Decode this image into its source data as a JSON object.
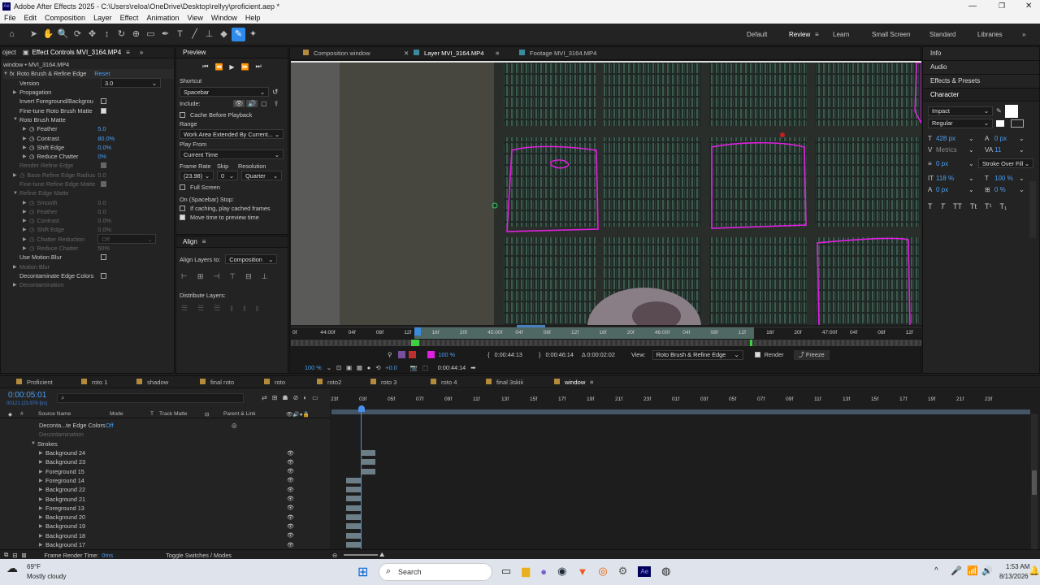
{
  "app": {
    "title": "Adobe After Effects 2025 - C:\\Users\\reloa\\OneDrive\\Desktop\\rellyy\\proficient.aep *"
  },
  "menu": [
    "File",
    "Edit",
    "Composition",
    "Layer",
    "Effect",
    "Animation",
    "View",
    "Window",
    "Help"
  ],
  "workspaces": [
    "Default",
    "Review",
    "Learn",
    "Small Screen",
    "Standard",
    "Libraries"
  ],
  "effect_panel": {
    "tab_left": "oject",
    "tab_title": "Effect Controls MVI_3164.MP4",
    "layer_label": "window • MVI_3164.MP4",
    "effect_name": "Roto Brush & Refine Edge",
    "reset": "Reset",
    "version_label": "Version",
    "version_value": "3.0",
    "propagation": "Propagation",
    "invert": "Invert Foreground/Backgrou",
    "finetune": "Fine-tune Roto Brush Matte",
    "roto_matte": "Roto Brush Matte",
    "feather": "Feather",
    "feather_v": "5.0",
    "contrast": "Contrast",
    "contrast_v": "80.0%",
    "shift": "Shift Edge",
    "shift_v": "0.0%",
    "reduce": "Reduce Chatter",
    "reduce_v": "0%",
    "render_refine": "Render Refine Edge",
    "base_radius": "Base Refine Edge Radius",
    "base_radius_v": "0.0",
    "finetune_refine": "Fine-tune Refine Edge Matte",
    "refine_matte": "Refine Edge Matte",
    "smooth": "Smooth",
    "smooth_v": "0.0",
    "feather2": "Feather",
    "feather2_v": "0.0",
    "contrast2": "Contrast",
    "contrast2_v": "0.0%",
    "shift2": "Shift Edge",
    "shift2_v": "0.0%",
    "chatter_red": "Chatter Reduction",
    "chatter_red_v": "Off",
    "reduce2": "Reduce Chatter",
    "reduce2_v": "50%",
    "motion_blur": "Use Motion Blur",
    "motion_blur2": "Motion Blur",
    "decont": "Decontaminate Edge Colors",
    "decont2": "Decontamination"
  },
  "preview": {
    "title": "Preview",
    "shortcut_label": "Shortcut",
    "shortcut": "Spacebar",
    "include": "Include:",
    "cache": "Cache Before Playback",
    "range_label": "Range",
    "range": "Work Area Extended By Current...",
    "playfrom_label": "Play From",
    "playfrom": "Current Time",
    "fr_label": "Frame Rate",
    "skip_label": "Skip",
    "res_label": "Resolution",
    "fr": "(23.98)",
    "skip": "0",
    "res": "Quarter",
    "fullscreen": "Full Screen",
    "stop_label": "On (Spacebar) Stop:",
    "stop1": "If caching, play cached frames",
    "stop2": "Move time to preview time"
  },
  "align": {
    "title": "Align",
    "align_to_label": "Align Layers to:",
    "align_to": "Composition",
    "distribute": "Distribute Layers:"
  },
  "viewer": {
    "tabs": [
      "Composition window",
      "Layer MVI_3164.MP4",
      "Footage MVI_3164.MP4"
    ],
    "ruler": [
      "0f",
      "44:00f",
      "04f",
      "08f",
      "12f",
      "16f",
      "20f",
      "45:00f",
      "04f",
      "08f",
      "12f",
      "16f",
      "20f",
      "46:00f",
      "04f",
      "08f",
      "12f",
      "16f",
      "20f",
      "47:00f",
      "04f",
      "08f",
      "12f"
    ],
    "zoom_pct": "100 %",
    "t1": "0:00:44:13",
    "t2": "0:00:46:14",
    "delta": "Δ 0:00:02:02",
    "view_label": "View:",
    "view": "Roto Brush & Refine Edge",
    "render": "Render",
    "freeze": "Freeze",
    "bottom_zoom": "100 %",
    "plus": "+0.0",
    "timecode": "0:00:44:14"
  },
  "right_panel": {
    "items": [
      "Info",
      "Audio",
      "Effects & Presets"
    ],
    "character": "Character",
    "font": "Impact",
    "style": "Regular",
    "size": "428 px",
    "kerning_lbl": "Metrics",
    "leading": "0 px",
    "tracking": "11",
    "stroke_w": "0 px",
    "stroke_type": "Stroke Over Fill",
    "vscale": "118 %",
    "hscale": "100 %",
    "baseline": "0 px",
    "tsume": "0 %"
  },
  "timeline": {
    "tabs": [
      "Proficient",
      "roto 1",
      "shadow",
      "final roto",
      "roto",
      "roto2",
      "roto 3",
      "roto 4",
      "final 3skiii",
      "window"
    ],
    "timecode": "0:00:05:01",
    "fps": "00121 (23.976 fps)",
    "cols": [
      "Source Name",
      "Mode",
      "T",
      "Track Matte",
      "Parent & Link"
    ],
    "ruler": [
      "23f",
      "03f",
      "05f",
      "07f",
      "09f",
      "11f",
      "13f",
      "15f",
      "17f",
      "19f",
      "21f",
      "23f",
      "01f",
      "03f",
      "05f",
      "07f",
      "09f",
      "11f",
      "13f",
      "15f",
      "17f",
      "19f",
      "21f",
      "23f"
    ],
    "rows": [
      {
        "name": "Deconta...te Edge Colors",
        "value": "Off",
        "indent": 1
      },
      {
        "name": "Decontamination",
        "dim": true,
        "indent": 1
      },
      {
        "name": "Strokes",
        "indent": 0
      },
      {
        "name": "Background 24",
        "indent": 1
      },
      {
        "name": "Background 23",
        "indent": 1
      },
      {
        "name": "Foreground 15",
        "indent": 1
      },
      {
        "name": "Foreground 14",
        "indent": 1
      },
      {
        "name": "Background 22",
        "indent": 1
      },
      {
        "name": "Background 21",
        "indent": 1
      },
      {
        "name": "Foreground 13",
        "indent": 1
      },
      {
        "name": "Background 20",
        "indent": 1
      },
      {
        "name": "Background 19",
        "indent": 1
      },
      {
        "name": "Background 18",
        "indent": 1
      },
      {
        "name": "Background 17",
        "indent": 1
      }
    ],
    "render_time_label": "Frame Render Time:",
    "render_time": "0ms",
    "toggle": "Toggle Switches / Modes"
  },
  "taskbar": {
    "temp": "69°F",
    "weather": "Mostly cloudy",
    "search": "Search",
    "time": "1:53 AM",
    "date": "8/13/2026"
  }
}
